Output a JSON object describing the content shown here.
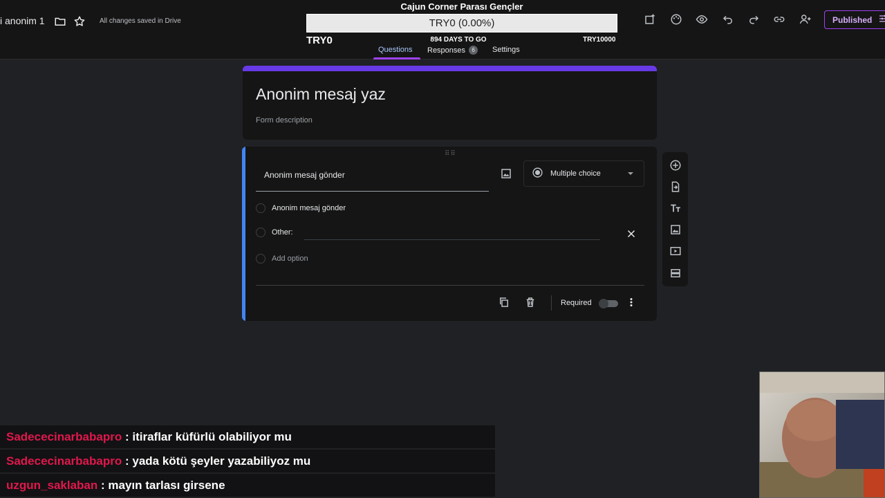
{
  "header": {
    "doc_title": "i anonim 1",
    "saved_status": "All changes saved in Drive",
    "published_label": "Published"
  },
  "goal": {
    "title": "Cajun Corner Parası Gençler",
    "progress_text": "TRY0 (0.00%)",
    "progress_fraction": 0.0,
    "min_label": "TRY0",
    "days_label": "894 DAYS TO GO",
    "max_label": "TRY10000"
  },
  "tabs": [
    {
      "label": "Questions",
      "active": true
    },
    {
      "label": "Responses",
      "badge": "6"
    },
    {
      "label": "Settings"
    }
  ],
  "form": {
    "title": "Anonim mesaj yaz",
    "description_placeholder": "Form description"
  },
  "question": {
    "title": "Anonim mesaj gönder",
    "type": "Multiple choice",
    "options": [
      "Anonim mesaj gönder"
    ],
    "other_label": "Other:",
    "add_option_label": "Add option",
    "required_label": "Required",
    "required": false
  },
  "chat": [
    {
      "user": "Sadececinarbabapro",
      "text": ": itiraflar küfürlü olabiliyor mu"
    },
    {
      "user": "Sadececinarbabapro",
      "text": ": yada kötü şeyler yazabiliyoz mu"
    },
    {
      "user": "uzgun_saklaban",
      "text": ": mayın tarlası girsene"
    }
  ],
  "colors": {
    "accent": "#673ae6",
    "question_accent": "#4285f4",
    "chat_user": "#e0184c"
  }
}
